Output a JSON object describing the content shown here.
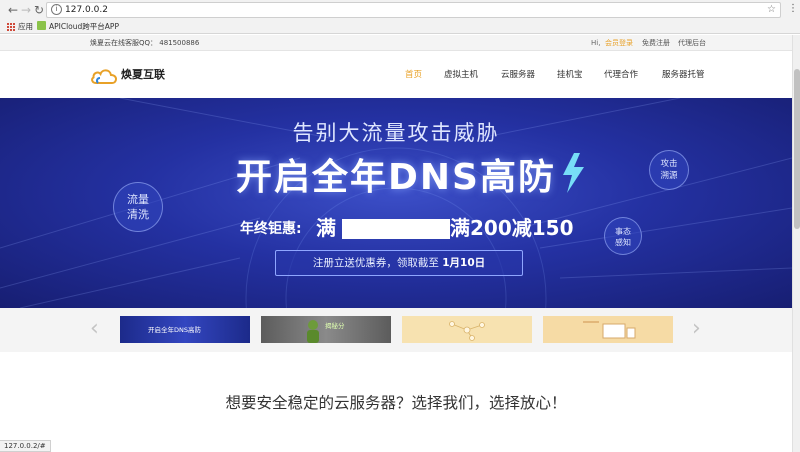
{
  "browser": {
    "url": "127.0.0.2",
    "bookmarks": [
      {
        "label": "应用",
        "icon": "apps-grid-icon"
      },
      {
        "label": "APICloud跨平台APP",
        "icon": "bookmark-favicon"
      }
    ]
  },
  "topbar": {
    "support": "焕夏云在线客服QQ： 481500886",
    "greeting": "Hi,",
    "login": "会员登录",
    "register": "免费注册",
    "agent": "代理后台"
  },
  "header": {
    "logo_text": "焕夏互联",
    "nav": [
      {
        "label": "首页",
        "active": true
      },
      {
        "label": "虚拟主机",
        "active": false
      },
      {
        "label": "云服务器",
        "active": false
      },
      {
        "label": "挂机宝",
        "active": false
      },
      {
        "label": "代理合作",
        "active": false
      },
      {
        "label": "服务器托管",
        "active": false
      }
    ]
  },
  "banner": {
    "line1": "告别大流量攻击威胁",
    "line2": "开启全年DNS高防",
    "promo_label": "年终钜惠:",
    "promo_prefix": "满",
    "promo_suffix": "满200减150",
    "coupon_text": "注册立送优惠券，领取截至",
    "coupon_date": "1月10日",
    "circle_left": [
      "流量",
      "清洗"
    ],
    "circle_right_top": [
      "攻击",
      "溯源"
    ],
    "circle_right_bottom": [
      "事态",
      "感知"
    ]
  },
  "thumbnails": [
    {
      "caption": "开启全年DNS高防"
    },
    {
      "caption": "揭秘分"
    },
    {
      "caption": ""
    },
    {
      "caption": ""
    }
  ],
  "slogan": "想要安全稳定的云服务器？选择我们，选择放心！",
  "status": "127.0.0.2/#",
  "colors": {
    "accent": "#e8a127",
    "banner_dark": "#171e72",
    "banner_light": "#3c4fc8"
  }
}
